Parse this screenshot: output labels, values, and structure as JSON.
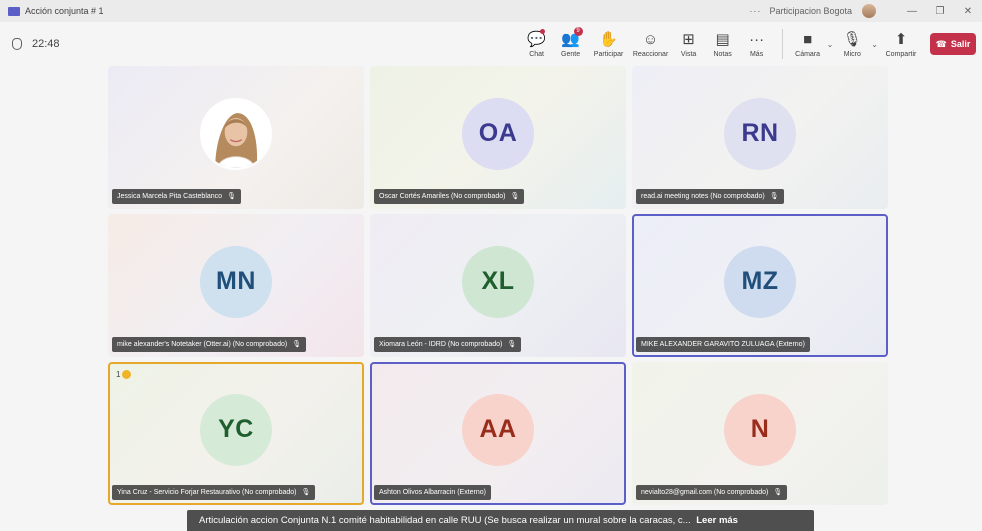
{
  "titlebar": {
    "title": "Acción conjunta # 1",
    "dots": "···",
    "meeting_name": "Participacion Bogota",
    "minimize": "—",
    "restore": "❐",
    "close": "✕"
  },
  "toolbar": {
    "timer": "22:48",
    "people_badge": "9",
    "chat": "Chat",
    "people": "Gente",
    "raise": "Participar",
    "react": "Reaccionar",
    "view": "Vista",
    "notes": "Notas",
    "more": "Más",
    "camera": "Cámara",
    "mic": "Micro",
    "share": "Compartir",
    "leave": "Salir"
  },
  "tiles": [
    {
      "initials": "",
      "name": "Jessica Marcela Pita Casteblanco",
      "avatar_bg": "#ffffff",
      "initials_color": "#242424",
      "muted": true
    },
    {
      "initials": "OA",
      "name": "Oscar Cortés Amariles (No comprobado)",
      "avatar_bg": "#dcdcf2",
      "initials_color": "#3b3a8f",
      "muted": true
    },
    {
      "initials": "RN",
      "name": "read.ai meeting notes (No comprobado)",
      "avatar_bg": "#dfe0f0",
      "initials_color": "#3b3a8f",
      "muted": true
    },
    {
      "initials": "MN",
      "name": "mike alexander's Notetaker (Otter.ai) (No comprobado)",
      "avatar_bg": "#cfe0ef",
      "initials_color": "#1f4f7a",
      "muted": true
    },
    {
      "initials": "XL",
      "name": "Xiomara León - IDRD (No comprobado)",
      "avatar_bg": "#cfe6d3",
      "initials_color": "#1f5e2e",
      "muted": true
    },
    {
      "initials": "MZ",
      "name": "MIKE ALEXANDER GARAVITO ZULUAGA (Externo)",
      "avatar_bg": "#cfdcef",
      "initials_color": "#1f4f7a",
      "muted": false
    },
    {
      "initials": "YC",
      "name": "Yina Cruz - Servicio Forjar Restaurativo (No comprobado)",
      "avatar_bg": "#d6ead8",
      "initials_color": "#1f5e2e",
      "muted": true,
      "hand": "1"
    },
    {
      "initials": "AA",
      "name": "Ashton Olivos Albarracin (Externo)",
      "avatar_bg": "#f7d3cb",
      "initials_color": "#9a2c1c",
      "muted": false
    },
    {
      "initials": "N",
      "name": "nevialto28@gmail.com (No comprobado)",
      "avatar_bg": "#f7d3cb",
      "initials_color": "#9a2c1c",
      "muted": true
    }
  ],
  "caption": {
    "text": "Articulación accion Conjunta N.1 comité habitabilidad en calle RUU (Se busca realizar un mural sobre la caracas, c...",
    "more": "Leer más"
  },
  "colors": {
    "accent": "#5b5fc7",
    "leave": "#c4314b",
    "hand": "#e5a82a"
  }
}
